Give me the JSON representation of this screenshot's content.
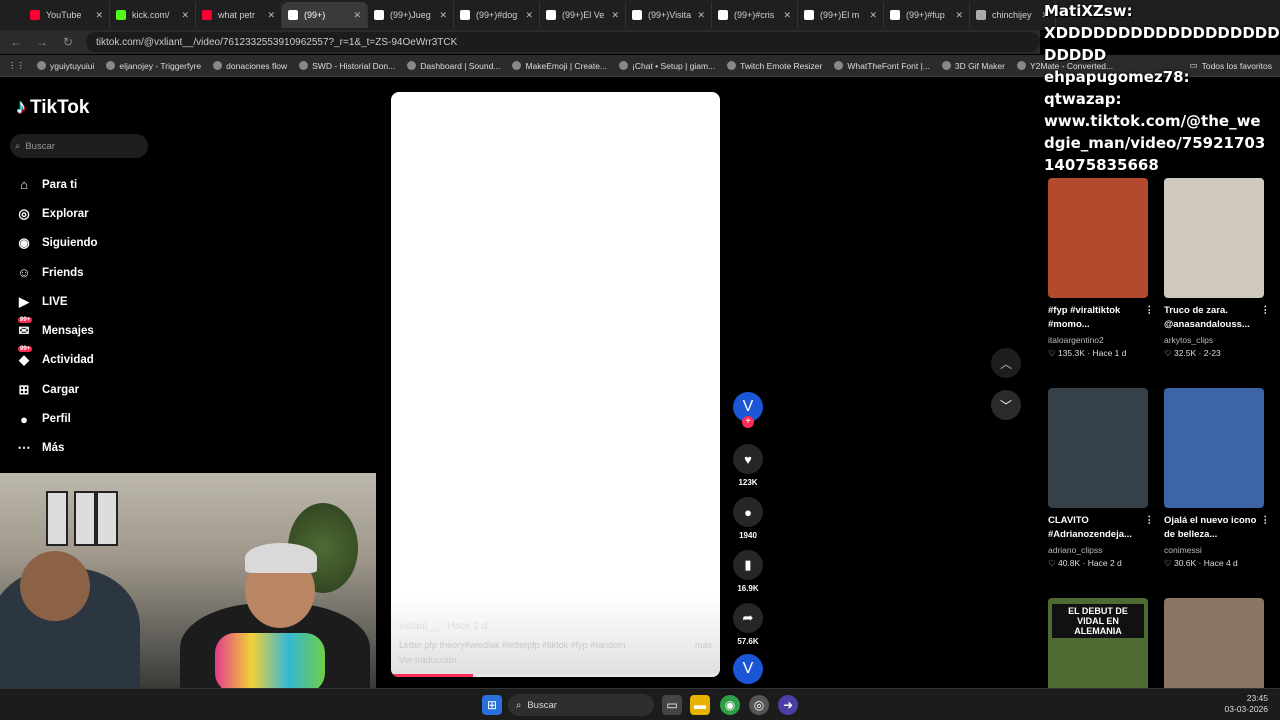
{
  "browser": {
    "tabs": [
      {
        "label": "YouTube",
        "color": "#ff0033"
      },
      {
        "label": "kick.com/",
        "color": "#53fc18"
      },
      {
        "label": "what petr",
        "color": "#ff0033"
      },
      {
        "label": "(99+)",
        "color": "#ffffff",
        "active": true
      },
      {
        "label": "(99+)Jueg",
        "color": "#ffffff"
      },
      {
        "label": "(99+)#dog",
        "color": "#ffffff"
      },
      {
        "label": "(99+)El Ve",
        "color": "#ffffff"
      },
      {
        "label": "(99+)Visita",
        "color": "#ffffff"
      },
      {
        "label": "(99+)#cris",
        "color": "#ffffff"
      },
      {
        "label": "(99+)El m",
        "color": "#ffffff"
      },
      {
        "label": "(99+)#fup",
        "color": "#ffffff"
      },
      {
        "label": "chinchijey",
        "color": "#aaaaaa"
      }
    ],
    "url": "tiktok.com/@vxliant__/video/7612332553910962557?_r=1&_t=ZS-94OeWrr3TCK",
    "bookmarks": [
      "yguiytuyuiui",
      "eljanojey - Triggerfyre",
      "donaciones flow",
      "SWD - Historial Don...",
      "Dashboard | Sound...",
      "MakeEmoji | Create...",
      "¡Chat • Setup | giam...",
      "Twitch Emote Resizer",
      "WhatTheFont Font |...",
      "3D Gif Maker",
      "Y2Mate - Converted..."
    ],
    "bookmarks_right": "Todos los favoritos"
  },
  "sidebar": {
    "logo": "TikTok",
    "search_placeholder": "Buscar",
    "items": [
      {
        "label": "Para ti",
        "icon": "home-icon"
      },
      {
        "label": "Explorar",
        "icon": "compass-icon"
      },
      {
        "label": "Siguiendo",
        "icon": "following-icon"
      },
      {
        "label": "Friends",
        "icon": "friends-icon"
      },
      {
        "label": "LIVE",
        "icon": "live-icon"
      },
      {
        "label": "Mensajes",
        "icon": "messages-icon",
        "badge": "99+"
      },
      {
        "label": "Actividad",
        "icon": "activity-icon",
        "badge": "99+"
      },
      {
        "label": "Cargar",
        "icon": "upload-icon"
      },
      {
        "label": "Perfil",
        "icon": "profile-icon"
      },
      {
        "label": "Más",
        "icon": "more-icon"
      }
    ]
  },
  "video": {
    "author": "vxliant__ · Hace 2 d",
    "caption": "Letter pfp theory#wiedlak #letterpfp #tiktok #fyp #random",
    "more": "más",
    "translate": "Ver traducción",
    "progress": 0.25
  },
  "actions": {
    "avatar_letter": "V",
    "likes": "123K",
    "comments": "1940",
    "saves": "16.9K",
    "shares": "57.6K"
  },
  "related": [
    {
      "title": "#fyp #viraltiktok #momo...",
      "author": "italoargentino2",
      "meta": "♡ 135.3K · Hace 1 d",
      "color": "#b34a2e"
    },
    {
      "title": "Truco de zara. @anasandalouss...",
      "author": "arkytos_clips",
      "meta": "♡ 32.5K · 2-23",
      "color": "#cfc9c0"
    },
    {
      "title": "CLAVITO #Adrianozendeja...",
      "author": "adriano_clipss",
      "meta": "♡ 40.8K · Hace 2 d",
      "color": "#364048"
    },
    {
      "title": "Ojalá el nuevo icono de belleza...",
      "author": "conimessi",
      "meta": "♡ 30.6K · Hace 4 d",
      "color": "#3d63a8"
    },
    {
      "title": "EL DEBUT DE VIDAL EN ALEMANIA",
      "author": "",
      "meta": "",
      "color": "#4f6b34"
    },
    {
      "title": "",
      "author": "",
      "meta": "",
      "color": "#8a7563"
    }
  ],
  "chat_overlay": {
    "lines": [
      "MatiXZsw:",
      "XDDDDDDDDDDDDDDDDDD",
      "DDDDD",
      "ehpapugomez78:",
      "qtwazap:",
      "www.tiktok.com/@the_we",
      "dgie_man/video/75921703",
      "14075835668"
    ]
  },
  "taskbar": {
    "search": "Buscar",
    "time": "23:45",
    "date": "03-03-2026"
  }
}
